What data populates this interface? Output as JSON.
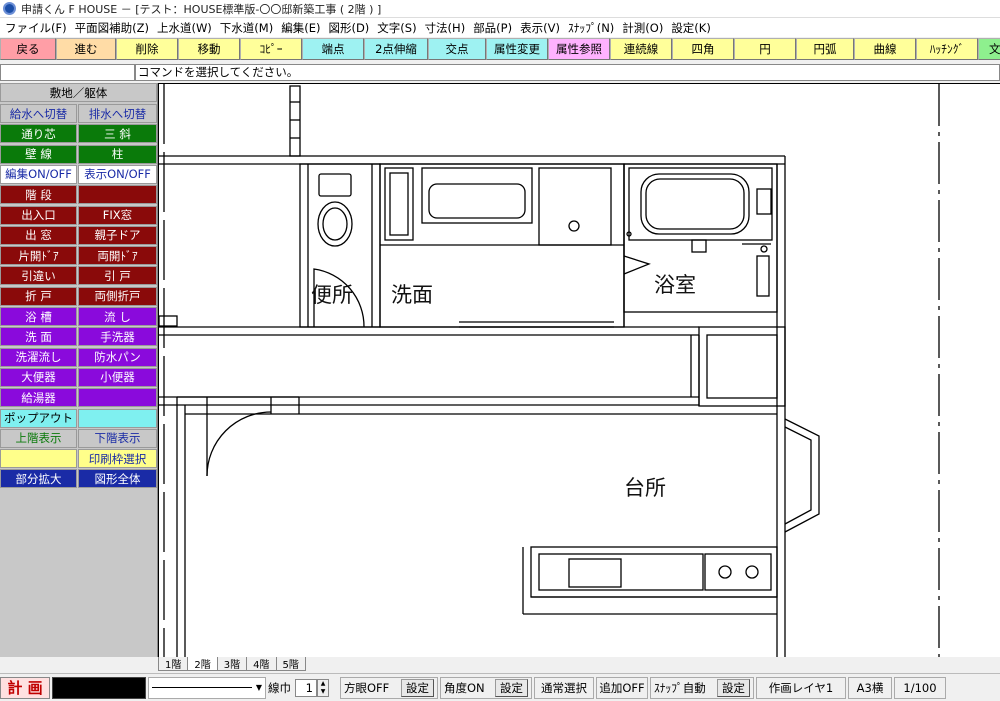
{
  "window": {
    "title": "申請くん F HOUSE － [テスト：HOUSE標準版-〇〇邸新築工事 ( 2階 ) ]"
  },
  "menu": [
    "ファイル(F)",
    "平面図補助(Z)",
    "上水道(W)",
    "下水道(M)",
    "編集(E)",
    "図形(D)",
    "文字(S)",
    "寸法(H)",
    "部品(P)",
    "表示(V)",
    "ｽﾅｯﾌﾟ(N)",
    "計測(O)",
    "設定(K)"
  ],
  "toolbar": [
    {
      "label": "戻る",
      "color": "#ff9ea6"
    },
    {
      "label": "進む",
      "color": "#ffdca6"
    },
    {
      "label": "削除",
      "color": "#ffff9a"
    },
    {
      "label": "移動",
      "color": "#ffff9a"
    },
    {
      "label": "ｺﾋﾟｰ",
      "color": "#ffff9a"
    },
    {
      "label": "端点",
      "color": "#9ef2f2"
    },
    {
      "label": "2点伸縮",
      "color": "#9ef2f2"
    },
    {
      "label": "交点",
      "color": "#9ef2f2"
    },
    {
      "label": "属性変更",
      "color": "#9ef2f2"
    },
    {
      "label": "属性参照",
      "color": "#ffb2ff"
    },
    {
      "label": "連続線",
      "color": "#ffff9a"
    },
    {
      "label": "四角",
      "color": "#ffff9a"
    },
    {
      "label": "円",
      "color": "#ffff9a"
    },
    {
      "label": "円弧",
      "color": "#ffff9a"
    },
    {
      "label": "曲線",
      "color": "#ffff9a"
    },
    {
      "label": "ﾊｯﾁﾝｸﾞ",
      "color": "#ffff9a"
    },
    {
      "label": "文字",
      "color": "#8ef08e"
    }
  ],
  "command": {
    "message": "コマンドを選択してください。"
  },
  "sidebar": {
    "header": "敷地／躯体",
    "rows": [
      [
        {
          "label": "給水へ切替",
          "bg": "#c8c8c8",
          "fg": "#1a2ba6"
        },
        {
          "label": "排水へ切替",
          "bg": "#c8c8c8",
          "fg": "#1a2ba6"
        }
      ],
      [
        {
          "label": "通り芯",
          "bg": "#0a7a0a",
          "fg": "#ffffff"
        },
        {
          "label": "三 斜",
          "bg": "#0a7a0a",
          "fg": "#ffffff"
        }
      ],
      [
        {
          "label": "壁 線",
          "bg": "#0a7a0a",
          "fg": "#ffffff"
        },
        {
          "label": "柱",
          "bg": "#0a7a0a",
          "fg": "#ffffff"
        }
      ],
      [
        {
          "label": "編集ON/OFF",
          "bg": "#ffffff",
          "fg": "#1a2ba6"
        },
        {
          "label": "表示ON/OFF",
          "bg": "#ffffff",
          "fg": "#1a2ba6"
        }
      ],
      [
        {
          "label": "階 段",
          "bg": "#8a0a0a",
          "fg": "#ffffff"
        },
        {
          "label": "",
          "bg": "#8a0a0a",
          "fg": "#ffffff"
        }
      ],
      [
        {
          "label": "出入口",
          "bg": "#8a0a0a",
          "fg": "#ffffff"
        },
        {
          "label": "FIX窓",
          "bg": "#8a0a0a",
          "fg": "#ffffff"
        }
      ],
      [
        {
          "label": "出 窓",
          "bg": "#8a0a0a",
          "fg": "#ffffff"
        },
        {
          "label": "親子ドア",
          "bg": "#8a0a0a",
          "fg": "#ffffff"
        }
      ],
      [
        {
          "label": "片開ﾄﾞｱ",
          "bg": "#8a0a0a",
          "fg": "#ffffff"
        },
        {
          "label": "両開ﾄﾞｱ",
          "bg": "#8a0a0a",
          "fg": "#ffffff"
        }
      ],
      [
        {
          "label": "引違い",
          "bg": "#8a0a0a",
          "fg": "#ffffff"
        },
        {
          "label": "引 戸",
          "bg": "#8a0a0a",
          "fg": "#ffffff"
        }
      ],
      [
        {
          "label": "折 戸",
          "bg": "#8a0a0a",
          "fg": "#ffffff"
        },
        {
          "label": "両側折戸",
          "bg": "#8a0a0a",
          "fg": "#ffffff"
        }
      ],
      [
        {
          "label": "浴 槽",
          "bg": "#8a0adc",
          "fg": "#ffffff"
        },
        {
          "label": "流 し",
          "bg": "#8a0adc",
          "fg": "#ffffff"
        }
      ],
      [
        {
          "label": "洗 面",
          "bg": "#8a0adc",
          "fg": "#ffffff"
        },
        {
          "label": "手洗器",
          "bg": "#8a0adc",
          "fg": "#ffffff"
        }
      ],
      [
        {
          "label": "洗濯流し",
          "bg": "#8a0adc",
          "fg": "#ffffff"
        },
        {
          "label": "防水パン",
          "bg": "#8a0adc",
          "fg": "#ffffff"
        }
      ],
      [
        {
          "label": "大便器",
          "bg": "#8a0adc",
          "fg": "#ffffff"
        },
        {
          "label": "小便器",
          "bg": "#8a0adc",
          "fg": "#ffffff"
        }
      ],
      [
        {
          "label": "給湯器",
          "bg": "#8a0adc",
          "fg": "#ffffff"
        },
        {
          "label": "",
          "bg": "#8a0adc",
          "fg": "#ffffff"
        }
      ],
      [
        {
          "label": "ポップアウト",
          "bg": "#7ff0f0",
          "fg": "#000000"
        },
        {
          "label": "",
          "bg": "#7ff0f0",
          "fg": "#000000"
        }
      ],
      [
        {
          "label": "上階表示",
          "bg": "#c8c8c8",
          "fg": "#0a7a0a"
        },
        {
          "label": "下階表示",
          "bg": "#c8c8c8",
          "fg": "#1a2ba6"
        }
      ],
      [
        {
          "label": "",
          "bg": "#ffff8a",
          "fg": "#000000"
        },
        {
          "label": "印刷枠選択",
          "bg": "#ffff8a",
          "fg": "#1a2ba6"
        }
      ],
      [
        {
          "label": "部分拡大",
          "bg": "#1a2ba6",
          "fg": "#ffffff"
        },
        {
          "label": "図形全体",
          "bg": "#1a2ba6",
          "fg": "#ffffff"
        }
      ]
    ]
  },
  "rooms": {
    "toilet": "便所",
    "washroom": "洗面",
    "bath": "浴室",
    "kitchen": "台所"
  },
  "floor_tabs": [
    "1階",
    "2階",
    "3階",
    "4階",
    "5階"
  ],
  "status": {
    "mode": "計 画",
    "line_width_label": "線巾",
    "line_width_value": "1",
    "grid": "方眼OFF",
    "grid_setting": "設定",
    "angle": "角度ON",
    "angle_setting": "設定",
    "select_mode": "通常選択",
    "append": "追加OFF",
    "snap": "ｽﾅｯﾌﾟ自動",
    "snap_setting": "設定",
    "layer": "作画レイヤ1",
    "paper": "A3横",
    "scale": "1/100"
  }
}
